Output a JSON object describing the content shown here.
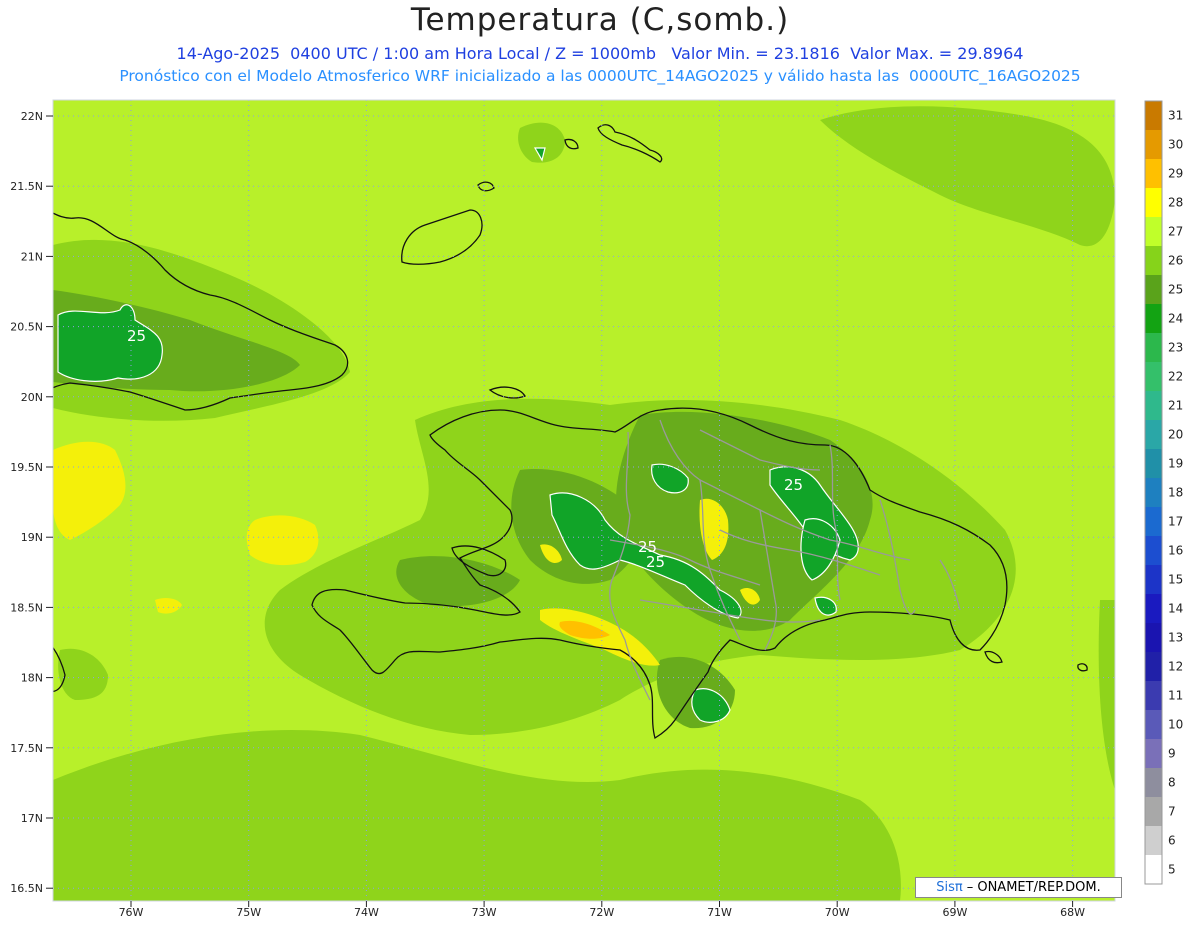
{
  "header": {
    "title": "Temperatura (C,somb.)",
    "subtitle_line1": "14-Ago-2025  0400 UTC / 1:00 am Hora Local / Z = 1000mb   Valor Min. = 23.1816  Valor Max. = 29.8964",
    "subtitle_line2": "Pronóstico con el Modelo Atmosferico WRF inicializado a las 0000UTC_14AGO2025 y válido hasta las  0000UTC_16AGO2025"
  },
  "credit": {
    "logo": "Sisπ",
    "text": "– ONAMET/REP.DOM."
  },
  "axes": {
    "lat_labels": [
      "22N",
      "21.5N",
      "21N",
      "20.5N",
      "20N",
      "19.5N",
      "19N",
      "18.5N",
      "18N",
      "17.5N",
      "17N",
      "16.5N"
    ],
    "lon_labels": [
      "76W",
      "75W",
      "74W",
      "73W",
      "72W",
      "71W",
      "70W",
      "69W",
      "68W"
    ]
  },
  "contour_labels": [
    "25",
    "25",
    "25",
    "25"
  ],
  "colorbar": {
    "levels": [
      "31",
      "30",
      "29",
      "28",
      "27",
      "26",
      "25",
      "24",
      "23",
      "22",
      "21",
      "20",
      "19",
      "18",
      "17",
      "16",
      "15",
      "14",
      "13",
      "12",
      "11",
      "10",
      "9",
      "8",
      "7",
      "6",
      "5"
    ],
    "colors": [
      "#c97a00",
      "#e59a00",
      "#ffc000",
      "#ffff00",
      "#c0ff2a",
      "#86d31a",
      "#5aa31b",
      "#13a313",
      "#2cb84c",
      "#34c06a",
      "#2fb98c",
      "#2aa7a7",
      "#2090a8",
      "#1e80c0",
      "#1b6ad0",
      "#1c4ed0",
      "#1c34c8",
      "#1a1ac0",
      "#1a14b0",
      "#2020a8",
      "#3b3bb0",
      "#5a5ab8",
      "#7a70b8",
      "#8e8e9e",
      "#a8a8a8",
      "#cfcfcf",
      "#ffffff"
    ]
  },
  "field_colors": {
    "base": "#b8f02a",
    "c26": "#8fd41b",
    "c25": "#68ac1c",
    "c24": "#11a428",
    "c28": "#f4f00a",
    "c29": "#ffc000"
  }
}
